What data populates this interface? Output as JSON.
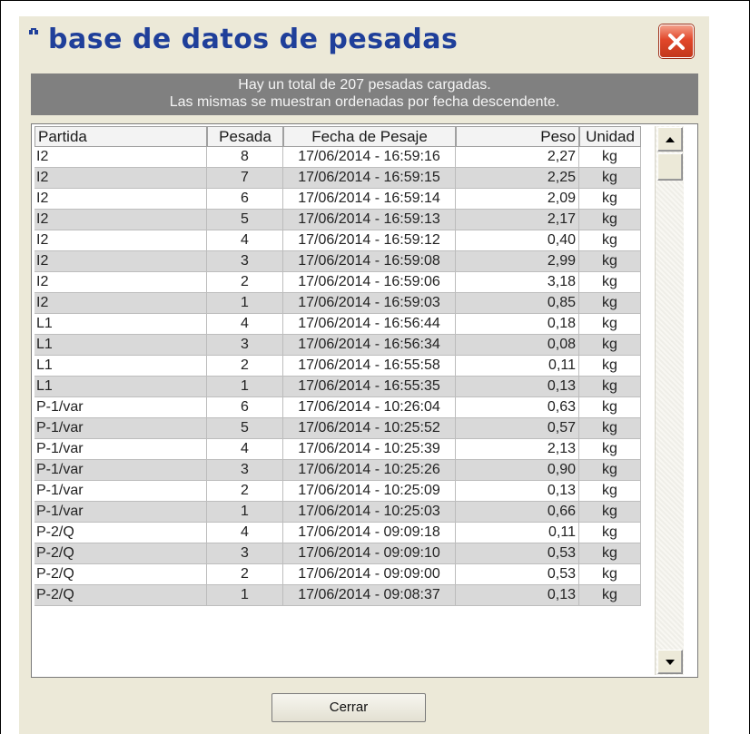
{
  "window": {
    "title": "base de datos de pesadas",
    "colors": {
      "title_text": "#1f3f9a",
      "close_button": "#e2472a",
      "banner": "#808080",
      "row_alt": "#d9d9d9"
    }
  },
  "banner": {
    "line1": "Hay un total de 207 pesadas cargadas.",
    "line2": "Las mismas se muestran ordenadas por fecha descendente."
  },
  "table": {
    "columns": [
      "Partida",
      "Pesada",
      "Fecha de Pesaje",
      "Peso",
      "Unidad"
    ],
    "rows": [
      [
        "I2",
        "8",
        "17/06/2014 - 16:59:16",
        "2,27",
        "kg"
      ],
      [
        "I2",
        "7",
        "17/06/2014 - 16:59:15",
        "2,25",
        "kg"
      ],
      [
        "I2",
        "6",
        "17/06/2014 - 16:59:14",
        "2,09",
        "kg"
      ],
      [
        "I2",
        "5",
        "17/06/2014 - 16:59:13",
        "2,17",
        "kg"
      ],
      [
        "I2",
        "4",
        "17/06/2014 - 16:59:12",
        "0,40",
        "kg"
      ],
      [
        "I2",
        "3",
        "17/06/2014 - 16:59:08",
        "2,99",
        "kg"
      ],
      [
        "I2",
        "2",
        "17/06/2014 - 16:59:06",
        "3,18",
        "kg"
      ],
      [
        "I2",
        "1",
        "17/06/2014 - 16:59:03",
        "0,85",
        "kg"
      ],
      [
        "L1",
        "4",
        "17/06/2014 - 16:56:44",
        "0,18",
        "kg"
      ],
      [
        "L1",
        "3",
        "17/06/2014 - 16:56:34",
        "0,08",
        "kg"
      ],
      [
        "L1",
        "2",
        "17/06/2014 - 16:55:58",
        "0,11",
        "kg"
      ],
      [
        "L1",
        "1",
        "17/06/2014 - 16:55:35",
        "0,13",
        "kg"
      ],
      [
        "P-1/var",
        "6",
        "17/06/2014 - 10:26:04",
        "0,63",
        "kg"
      ],
      [
        "P-1/var",
        "5",
        "17/06/2014 - 10:25:52",
        "0,57",
        "kg"
      ],
      [
        "P-1/var",
        "4",
        "17/06/2014 - 10:25:39",
        "2,13",
        "kg"
      ],
      [
        "P-1/var",
        "3",
        "17/06/2014 - 10:25:26",
        "0,90",
        "kg"
      ],
      [
        "P-1/var",
        "2",
        "17/06/2014 - 10:25:09",
        "0,13",
        "kg"
      ],
      [
        "P-1/var",
        "1",
        "17/06/2014 - 10:25:03",
        "0,66",
        "kg"
      ],
      [
        "P-2/Q",
        "4",
        "17/06/2014 - 09:09:18",
        "0,11",
        "kg"
      ],
      [
        "P-2/Q",
        "3",
        "17/06/2014 - 09:09:10",
        "0,53",
        "kg"
      ],
      [
        "P-2/Q",
        "2",
        "17/06/2014 - 09:09:00",
        "0,53",
        "kg"
      ],
      [
        "P-2/Q",
        "1",
        "17/06/2014 - 09:08:37",
        "0,13",
        "kg"
      ]
    ]
  },
  "icons": {
    "title": "app-icon",
    "close": "close-icon",
    "up": "scroll-up-arrow-icon",
    "down": "scroll-down-arrow-icon"
  },
  "footer": {
    "close_label": "Cerrar"
  }
}
